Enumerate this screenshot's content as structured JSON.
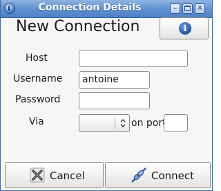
{
  "window": {
    "title": "Connection Details",
    "controls": {
      "minimize": "–",
      "close": "✕"
    },
    "app_icon": "app-icon"
  },
  "heading": "New Connection",
  "info_button": {
    "icon": "info-icon",
    "glyph": "i"
  },
  "form": {
    "host_label": "Host",
    "host_value": "",
    "username_label": "Username",
    "username_value": "antoine",
    "password_label": "Password",
    "password_value": "",
    "via_label": "Via",
    "via_value": "",
    "on_port_label": "on port",
    "port_value": ""
  },
  "buttons": {
    "cancel": "Cancel",
    "connect": "Connect"
  },
  "colors": {
    "titlebar": "#5e8fd0",
    "window_bg": "#f6f6f4",
    "info_icon": "#1f4f9c"
  }
}
